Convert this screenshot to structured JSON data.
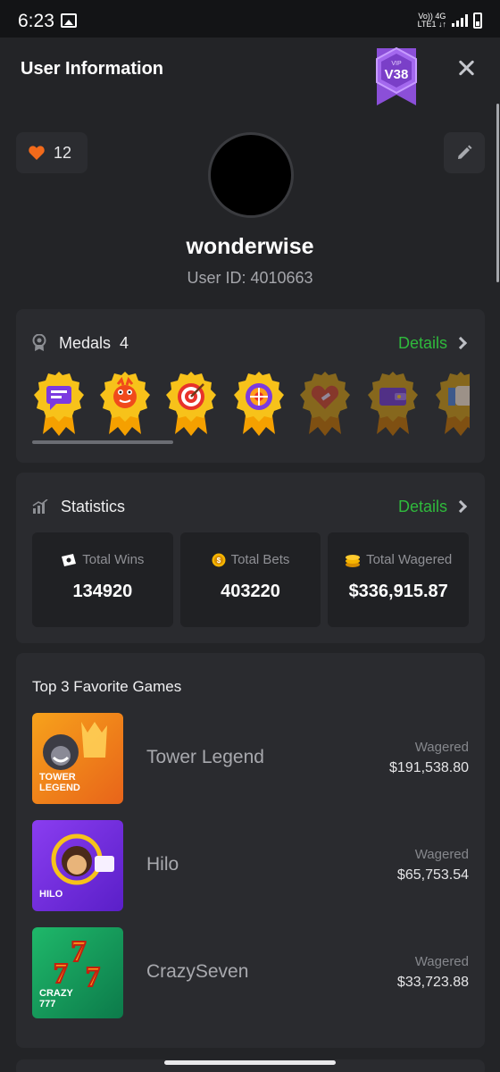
{
  "status_bar": {
    "time": "6:23",
    "network_top": "Vo)) 4G",
    "network_bottom": "LTE1 ↓↑"
  },
  "header": {
    "title": "User Information",
    "vip_small": "VIP",
    "vip_level": "V38"
  },
  "profile": {
    "likes": "12",
    "username": "wonderwise",
    "user_id": "User ID: 4010663"
  },
  "medals": {
    "label": "Medals",
    "count": "4",
    "details": "Details",
    "items": [
      {
        "name": "chat",
        "earned": true
      },
      {
        "name": "dragon",
        "earned": true
      },
      {
        "name": "target",
        "earned": true
      },
      {
        "name": "wheel",
        "earned": true
      },
      {
        "name": "heart",
        "earned": false
      },
      {
        "name": "wallet",
        "earned": false
      },
      {
        "name": "hand",
        "earned": false
      }
    ]
  },
  "statistics": {
    "label": "Statistics",
    "details": "Details",
    "items": [
      {
        "label": "Total Wins",
        "value": "134920"
      },
      {
        "label": "Total Bets",
        "value": "403220"
      },
      {
        "label": "Total Wagered",
        "value": "$336,915.87"
      }
    ]
  },
  "favorites": {
    "title": "Top 3 Favorite Games",
    "games": [
      {
        "name": "Tower Legend",
        "wagered_label": "Wagered",
        "wagered": "$191,538.80",
        "thumb_text": "TOWER LEGEND"
      },
      {
        "name": "Hilo",
        "wagered_label": "Wagered",
        "wagered": "$65,753.54",
        "thumb_text": "HILO"
      },
      {
        "name": "CrazySeven",
        "wagered_label": "Wagered",
        "wagered": "$33,723.88",
        "thumb_text": "CRAZY 777"
      }
    ]
  },
  "colors": {
    "accent_green": "#2fba3c",
    "vip_purple": "#8b4fd8",
    "heart_orange": "#f26a1b",
    "gold": "#f5b400"
  }
}
